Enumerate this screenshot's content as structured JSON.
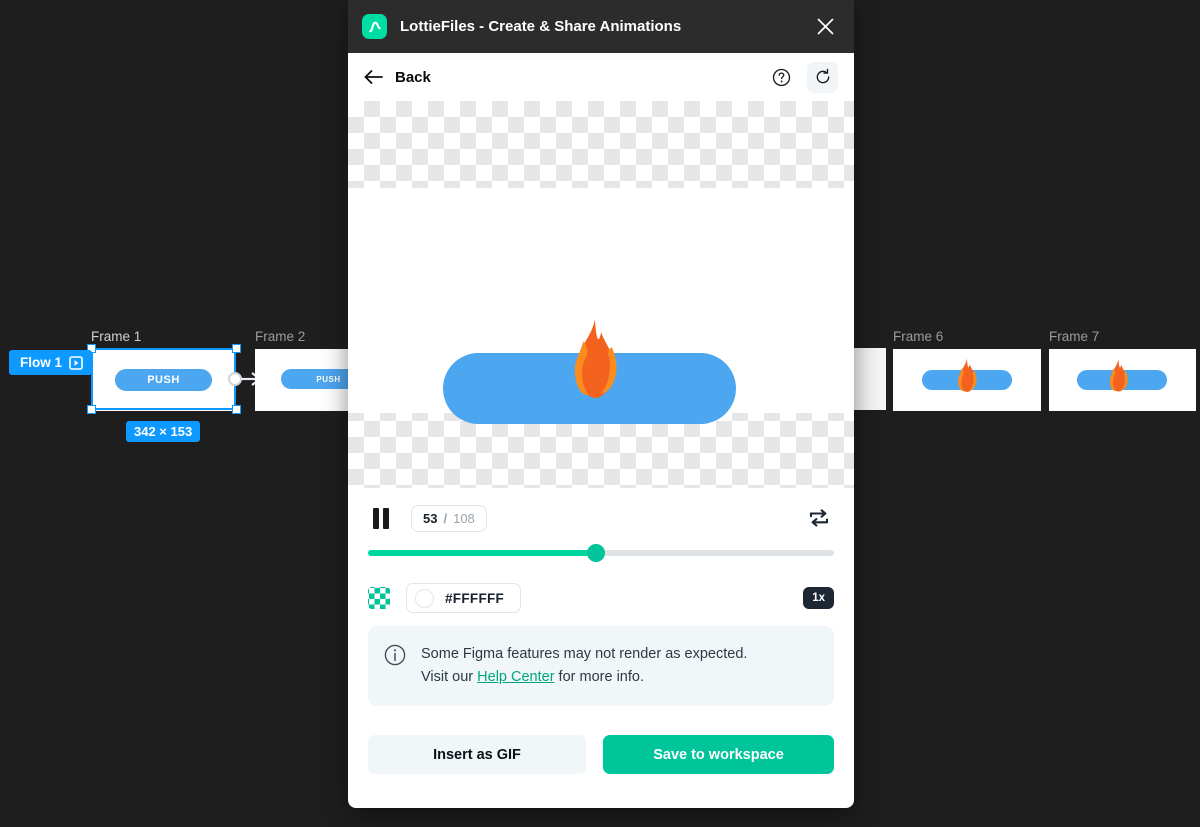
{
  "canvas": {
    "background_color": "#1e1e1e",
    "flow_badge": {
      "label": "Flow 1",
      "icon": "play-flow-icon"
    },
    "selection": {
      "dimensions_label": "342 × 153",
      "accent_color": "#0d99ff"
    },
    "frames": [
      {
        "label": "Frame 1",
        "state": "selected"
      },
      {
        "label": "Frame 2",
        "state": "normal"
      },
      {
        "label": "Frame 6",
        "state": "normal"
      },
      {
        "label": "Frame 7",
        "state": "normal"
      }
    ],
    "button_label": "PUSH",
    "button_color": "#4DA6F0"
  },
  "modal": {
    "titlebar": {
      "app_name": "LottieFiles - Create & Share Animations",
      "logo_icon": "lottiefiles-logo-icon",
      "logo_color": "#00DDA3",
      "close_icon": "close-icon"
    },
    "toolbar": {
      "back_label": "Back",
      "back_icon": "arrow-left-icon",
      "help_icon": "question-circle-icon",
      "refresh_icon": "refresh-icon"
    },
    "preview": {
      "background": "transparent-checkerboard",
      "artboard_color": "#FFFFFF",
      "content": "push-button-with-flame"
    },
    "playback": {
      "state": "playing",
      "play_pause_icon": "pause-icon",
      "current_frame": "53",
      "frame_separator": "/",
      "total_frames": "108",
      "loop_icon": "loop-icon",
      "loop_enabled": true,
      "progress_percent": 49,
      "track_color": "#dfe3e6",
      "fill_color": "#00D7A0"
    },
    "background_settings": {
      "transparency_icon": "checkerboard-swatch-icon",
      "color_value": "#FFFFFF",
      "color_swatch_icon": "color-circle-icon",
      "speed_label": "1x"
    },
    "notice": {
      "icon": "info-circle-icon",
      "line1": "Some Figma features may not render as expected.",
      "line2_prefix": "Visit our ",
      "link_label": "Help Center",
      "line2_suffix": " for more info.",
      "link_color": "#00A67E"
    },
    "footer": {
      "insert_gif_label": "Insert as GIF",
      "save_workspace_label": "Save to workspace",
      "primary_color": "#00C49A"
    }
  }
}
